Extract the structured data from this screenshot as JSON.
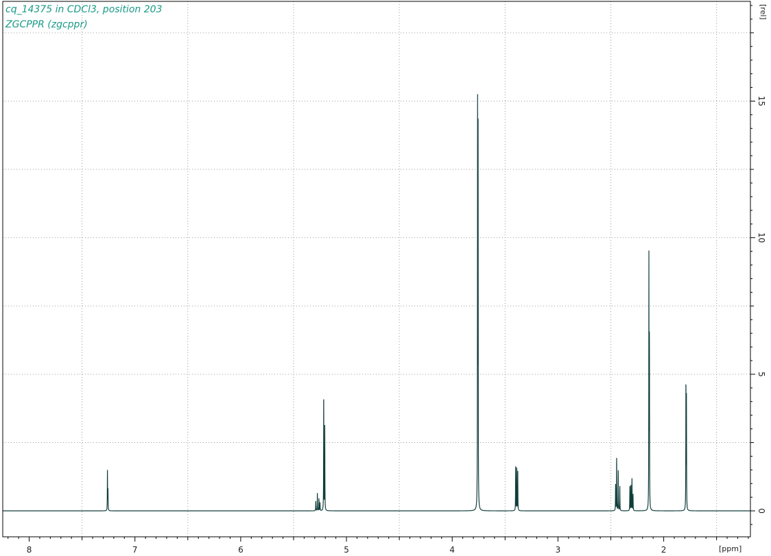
{
  "title_lines": [
    "cq_14375 in CDCl3, position 203",
    "ZGCPPR (zgcppr)"
  ],
  "colors": {
    "title": "#1a9a86",
    "spectrum": "#0f3d3a",
    "grid": "#9a9a9a",
    "frame": "#000000"
  },
  "chart_data": {
    "type": "line",
    "title": "cq_14375 in CDCl3, position 203",
    "subtitle": "ZGCPPR (zgcppr)",
    "xlabel": "[ppm]",
    "ylabel": "[rel]",
    "xlim": [
      8.25,
      1.18
    ],
    "ylim": [
      -0.95,
      18.65
    ],
    "x_reversed": true,
    "grid": true,
    "xticks": [
      8,
      7,
      6,
      5,
      4,
      3,
      2
    ],
    "yticks": [
      0,
      5,
      10,
      15
    ],
    "peaks": [
      {
        "x": 7.26,
        "y": 1.5
      },
      {
        "x": 7.255,
        "y": 0.8
      },
      {
        "x": 5.29,
        "y": 0.35
      },
      {
        "x": 5.275,
        "y": 0.65
      },
      {
        "x": 5.26,
        "y": 0.45
      },
      {
        "x": 5.25,
        "y": 0.3
      },
      {
        "x": 5.215,
        "y": 4.45
      },
      {
        "x": 5.205,
        "y": 3.15
      },
      {
        "x": 3.76,
        "y": 15.0
      },
      {
        "x": 3.755,
        "y": 13.55
      },
      {
        "x": 3.4,
        "y": 1.6
      },
      {
        "x": 3.39,
        "y": 1.6
      },
      {
        "x": 3.38,
        "y": 1.55
      },
      {
        "x": 2.455,
        "y": 0.95
      },
      {
        "x": 2.445,
        "y": 2.0
      },
      {
        "x": 2.43,
        "y": 1.5
      },
      {
        "x": 2.415,
        "y": 0.9
      },
      {
        "x": 2.32,
        "y": 0.9
      },
      {
        "x": 2.31,
        "y": 1.0
      },
      {
        "x": 2.3,
        "y": 1.2
      },
      {
        "x": 2.29,
        "y": 0.6
      },
      {
        "x": 2.14,
        "y": 9.2
      },
      {
        "x": 2.135,
        "y": 6.25
      },
      {
        "x": 1.79,
        "y": 4.85
      },
      {
        "x": 1.785,
        "y": 4.1
      }
    ]
  }
}
